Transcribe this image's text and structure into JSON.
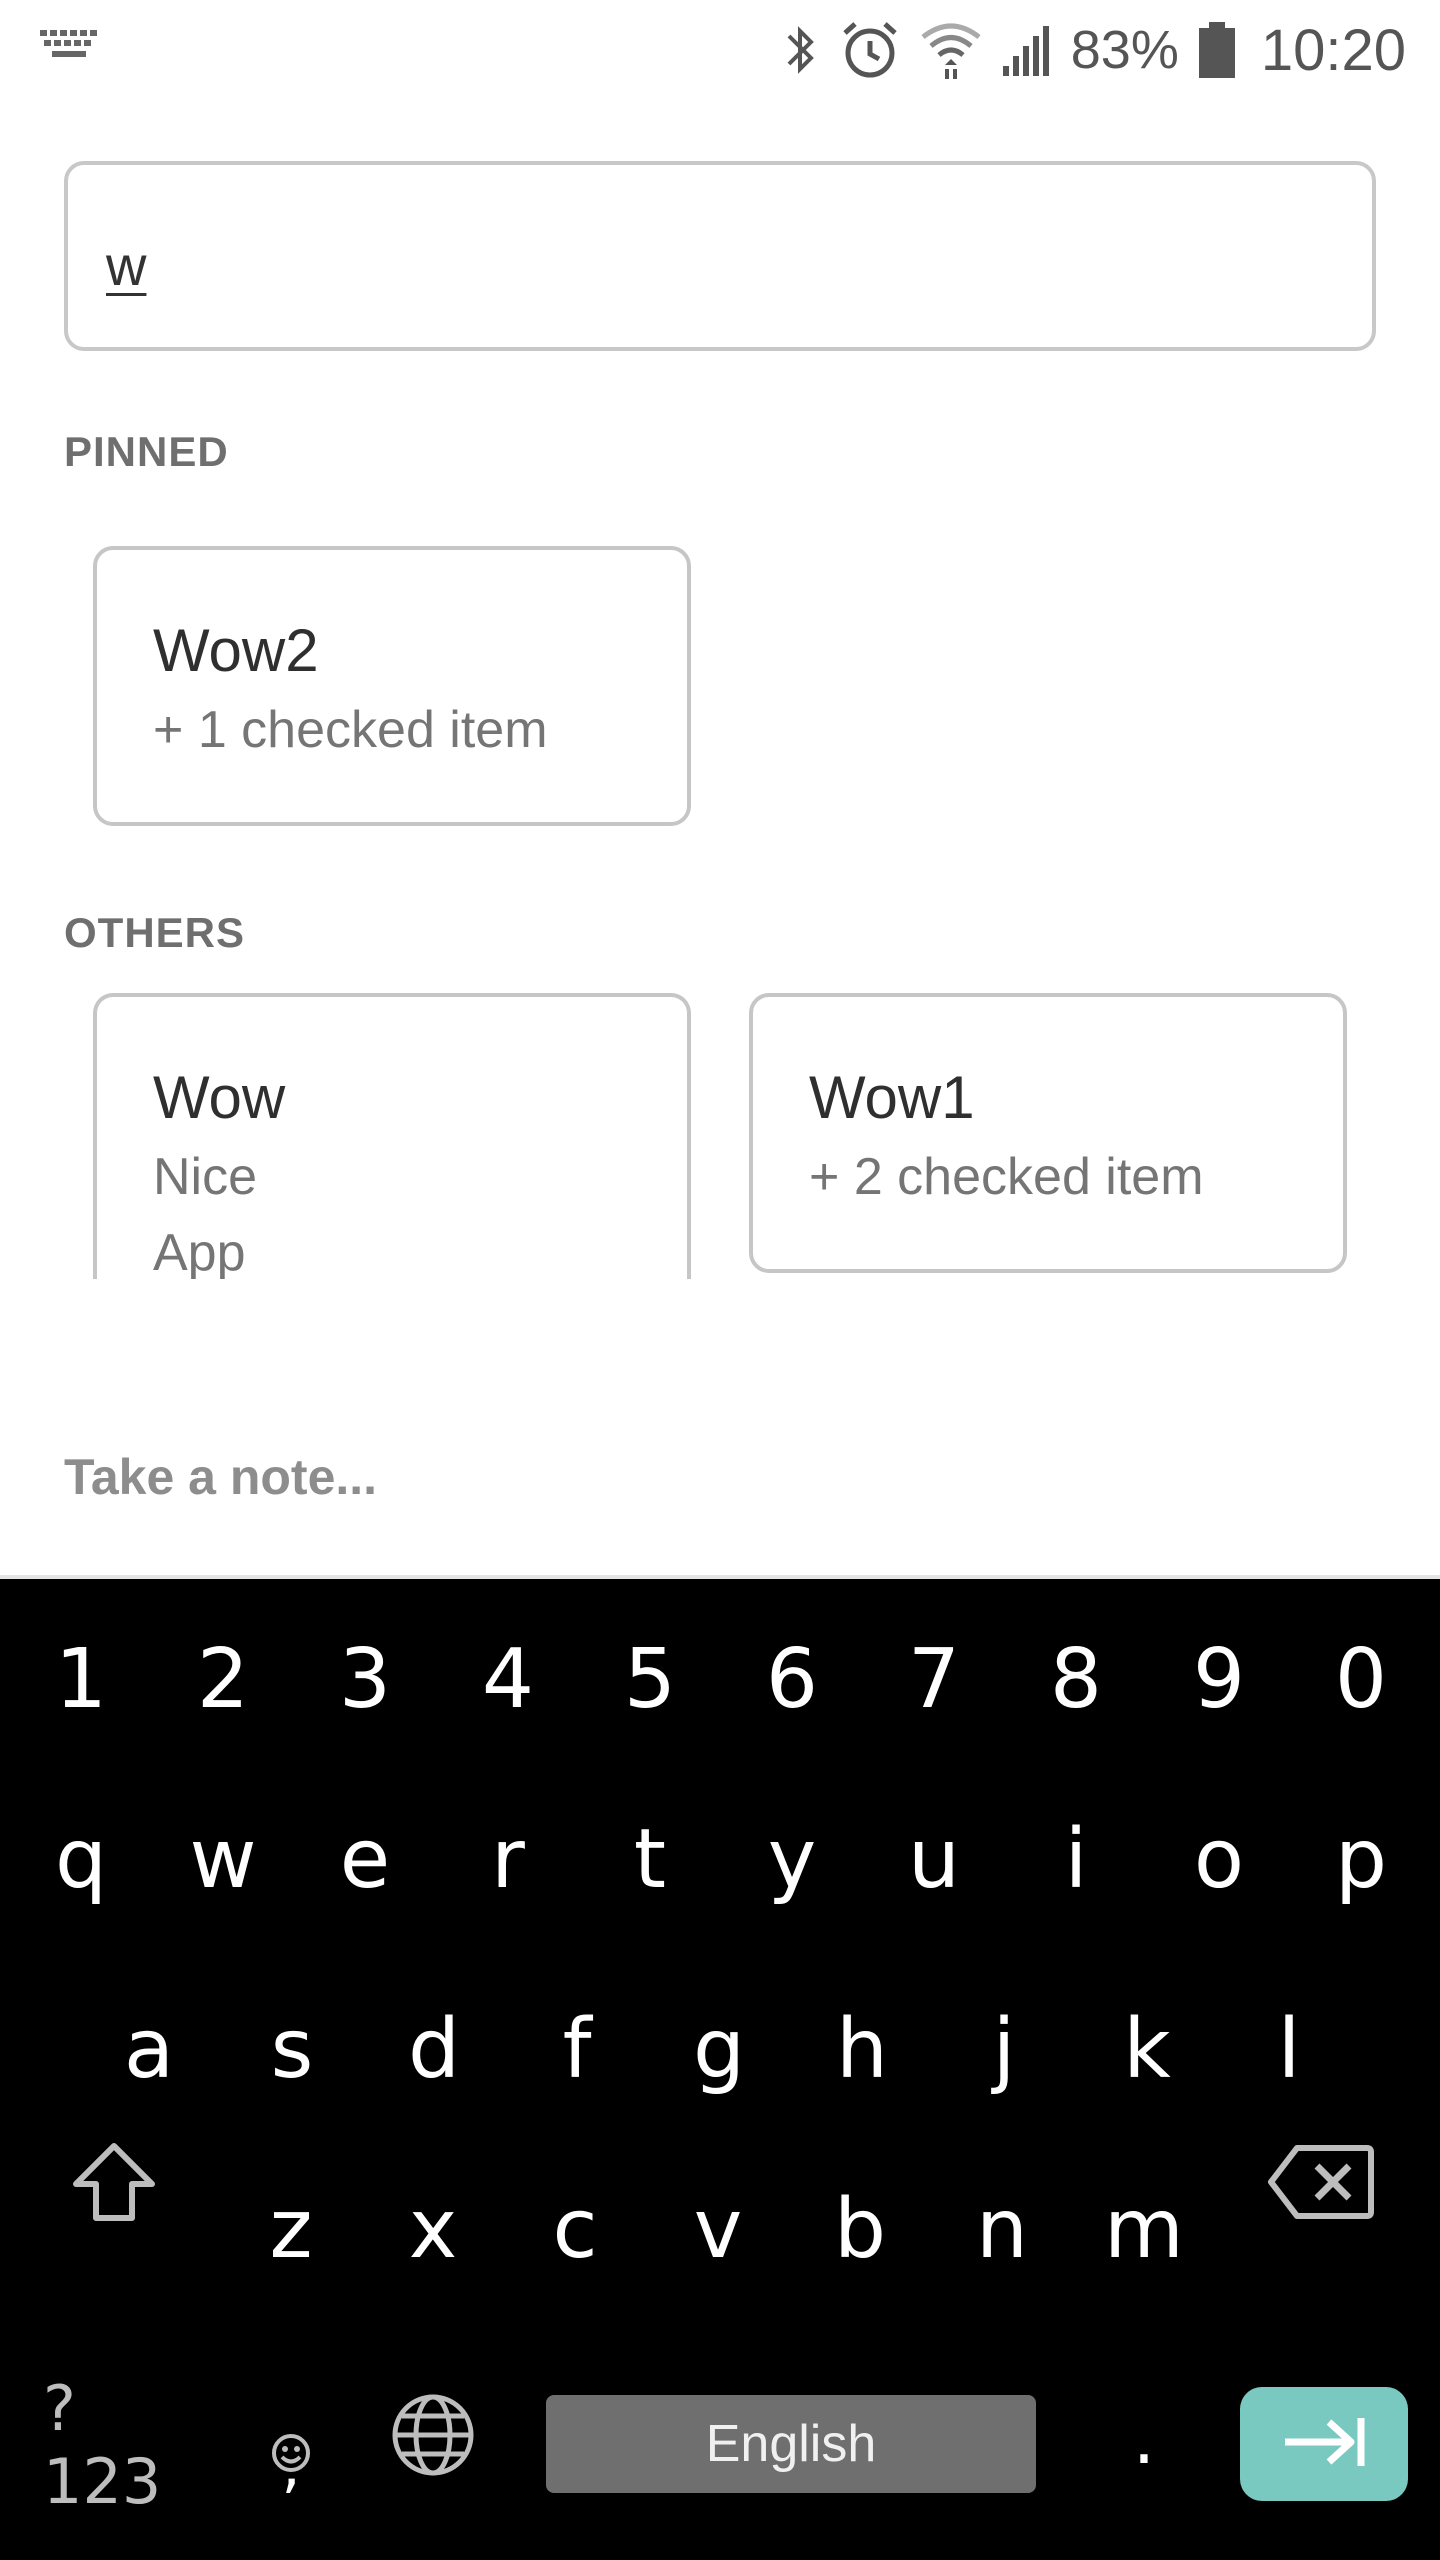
{
  "status_bar": {
    "battery": "83%",
    "time": "10:20"
  },
  "search": {
    "value": "w"
  },
  "sections": {
    "pinned_label": "PINNED",
    "others_label": "OTHERS"
  },
  "notes": {
    "pinned": [
      {
        "title": "Wow2",
        "lines": [
          "+ 1 checked item"
        ]
      }
    ],
    "others": [
      {
        "title": "Wow",
        "lines": [
          "Nice",
          "App"
        ]
      },
      {
        "title": "Wow1",
        "lines": [
          "+ 2 checked item"
        ]
      }
    ]
  },
  "take_note": {
    "placeholder": "Take a note..."
  },
  "keyboard": {
    "number_row": [
      "1",
      "2",
      "3",
      "4",
      "5",
      "6",
      "7",
      "8",
      "9",
      "0"
    ],
    "row1": [
      "q",
      "w",
      "e",
      "r",
      "t",
      "y",
      "u",
      "i",
      "o",
      "p"
    ],
    "row2": [
      "a",
      "s",
      "d",
      "f",
      "g",
      "h",
      "j",
      "k",
      "l"
    ],
    "row3": [
      "z",
      "x",
      "c",
      "v",
      "b",
      "n",
      "m"
    ],
    "symbols_label": "?123",
    "comma_label": ",",
    "space_label": "English",
    "period_label": "."
  }
}
